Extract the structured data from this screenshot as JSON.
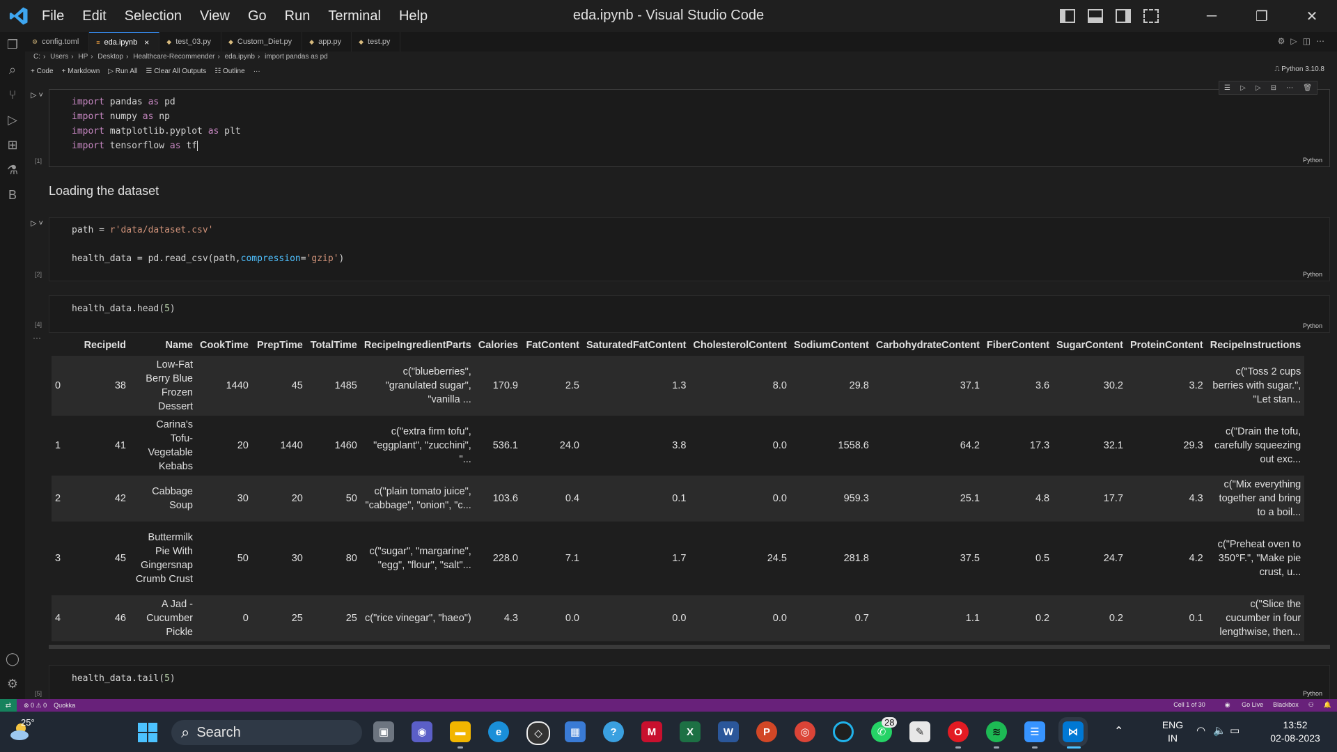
{
  "window": {
    "title": "eda.ipynb - Visual Studio Code",
    "menu": [
      "File",
      "Edit",
      "Selection",
      "View",
      "Go",
      "Run",
      "Terminal",
      "Help"
    ]
  },
  "activity_bar": [
    "files-icon",
    "search-icon",
    "source-control-icon",
    "run-debug-icon",
    "extensions-icon",
    "testing-icon",
    "blackbox-icon"
  ],
  "activity_bar_bottom": [
    "account-icon",
    "settings-gear-icon"
  ],
  "activity_badge": "B",
  "tabs": [
    {
      "label": "config.toml"
    },
    {
      "label": "eda.ipynb",
      "active": true
    },
    {
      "label": "test_03.py"
    },
    {
      "label": "Custom_Diet.py"
    },
    {
      "label": "app.py"
    },
    {
      "label": "test.py"
    }
  ],
  "breadcrumbs": [
    "C:",
    "Users",
    "HP",
    "Desktop",
    "Healthcare-Recommender",
    "eda.ipynb",
    "import pandas as pd"
  ],
  "toolbar": {
    "code": "Code",
    "markdown": "Markdown",
    "run_all": "Run All",
    "clear": "Clear All Outputs",
    "outline": "Outline",
    "more": "···",
    "kernel": "Python 3.10.8"
  },
  "cells": {
    "c1": {
      "count": "[1]",
      "lang": "Python"
    },
    "md": "Loading the dataset",
    "c2": {
      "count": "[2]",
      "lang": "Python"
    },
    "c3": {
      "count": "[4]",
      "lang": "Python"
    },
    "c4": {
      "count": "[5]",
      "lang": "Python"
    }
  },
  "dataframe": {
    "columns": [
      "",
      "RecipeId",
      "Name",
      "CookTime",
      "PrepTime",
      "TotalTime",
      "RecipeIngredientParts",
      "Calories",
      "FatContent",
      "SaturatedFatContent",
      "CholesterolContent",
      "SodiumContent",
      "CarbohydrateContent",
      "FiberContent",
      "SugarContent",
      "ProteinContent",
      "RecipeInstructions"
    ],
    "rows": [
      [
        "0",
        "38",
        "Low-Fat Berry Blue Frozen Dessert",
        "1440",
        "45",
        "1485",
        "c(\"blueberries\", \"granulated sugar\", \"vanilla ...",
        "170.9",
        "2.5",
        "1.3",
        "8.0",
        "29.8",
        "37.1",
        "3.6",
        "30.2",
        "3.2",
        "c(\"Toss 2 cups berries with sugar.\", \"Let stan..."
      ],
      [
        "1",
        "41",
        "Carina's Tofu-Vegetable Kebabs",
        "20",
        "1440",
        "1460",
        "c(\"extra firm tofu\", \"eggplant\", \"zucchini\", \"...",
        "536.1",
        "24.0",
        "3.8",
        "0.0",
        "1558.6",
        "64.2",
        "17.3",
        "32.1",
        "29.3",
        "c(\"Drain the tofu, carefully squeezing out exc..."
      ],
      [
        "2",
        "42",
        "Cabbage Soup",
        "30",
        "20",
        "50",
        "c(\"plain tomato juice\", \"cabbage\", \"onion\", \"c...",
        "103.6",
        "0.4",
        "0.1",
        "0.0",
        "959.3",
        "25.1",
        "4.8",
        "17.7",
        "4.3",
        "c(\"Mix everything together and bring to a boil..."
      ],
      [
        "3",
        "45",
        "Buttermilk Pie With Gingersnap Crumb Crust",
        "50",
        "30",
        "80",
        "c(\"sugar\", \"margarine\", \"egg\", \"flour\", \"salt\"...",
        "228.0",
        "7.1",
        "1.7",
        "24.5",
        "281.8",
        "37.5",
        "0.5",
        "24.7",
        "4.2",
        "c(\"Preheat oven to 350°F.\", \"Make pie crust, u..."
      ],
      [
        "4",
        "46",
        "A Jad - Cucumber Pickle",
        "0",
        "25",
        "25",
        "c(\"rice vinegar\", \"haeo\")",
        "4.3",
        "0.0",
        "0.0",
        "0.0",
        "0.7",
        "1.1",
        "0.2",
        "0.2",
        "0.1",
        "c(\"Slice the cucumber in four lengthwise, then..."
      ]
    ]
  },
  "statusbar": {
    "problems": "⊗ 0 ⚠ 0",
    "quokka": "Quokka",
    "cell": "Cell 1 of 30",
    "golive": "Go Live",
    "blackbox": "Blackbox"
  },
  "taskbar": {
    "temperature": "25°",
    "search": "Search",
    "whatsapp_badge": "28",
    "lang_top": "ENG",
    "lang_bottom": "IN",
    "time": "13:52",
    "date": "02-08-2023"
  },
  "colors": {
    "accent": "#3794ff",
    "statusbar": "#68217a",
    "keyword": "#c586c0",
    "string": "#ce9178",
    "parameter": "#4fc1ff"
  }
}
